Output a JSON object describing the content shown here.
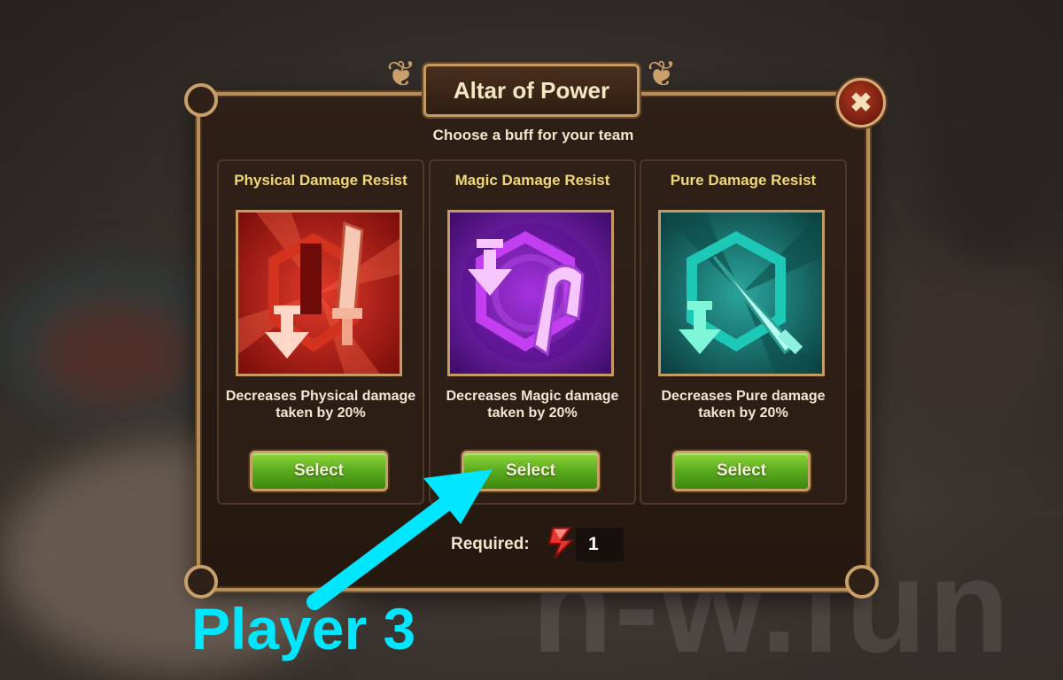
{
  "dialog": {
    "title": "Altar of Power",
    "subtitle": "Choose a buff for your team",
    "close_icon": "close-x-icon"
  },
  "cards": [
    {
      "title": "Physical Damage Resist",
      "description_line1": "Decreases Physical damage",
      "description_line2": "taken by 20%",
      "button": "Select",
      "icon": "physical-resist-sword-icon",
      "color": "#c8231b"
    },
    {
      "title": "Magic Damage Resist",
      "description_line1": "Decreases Magic damage",
      "description_line2": "taken by 20%",
      "button": "Select",
      "icon": "magic-resist-staff-icon",
      "color": "#8a28c8"
    },
    {
      "title": "Pure Damage Resist",
      "description_line1": "Decreases Pure damage",
      "description_line2": "taken by 20%",
      "button": "Select",
      "icon": "pure-resist-dagger-icon",
      "color": "#1f8e86"
    }
  ],
  "requirement": {
    "label": "Required:",
    "value": "1",
    "icon": "red-lightning-token-icon"
  },
  "annotation": {
    "text": "Player 3",
    "color": "#00e6ff"
  },
  "watermark": "h-w.fun"
}
